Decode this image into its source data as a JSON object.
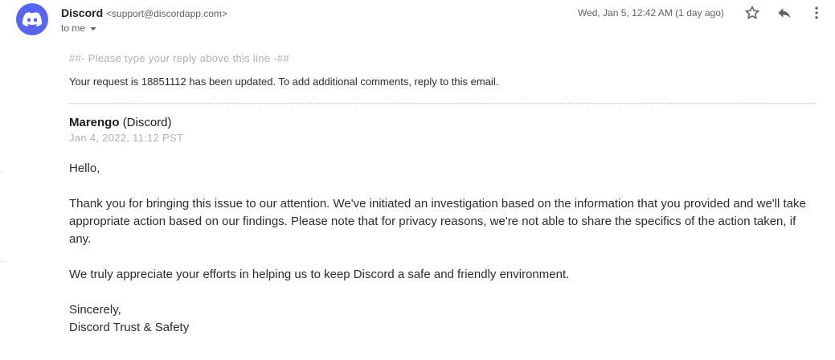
{
  "sender": {
    "name": "Discord",
    "email": "<support@discordapp.com>",
    "avatar_color": "#5865F2",
    "avatar_icon": "discord-logo-icon"
  },
  "recipient": {
    "label": "to me"
  },
  "header": {
    "date": "Wed, Jan 5, 12:42 AM (1 day ago)",
    "actions": {
      "star_icon": "star-icon",
      "reply_icon": "reply-icon",
      "more_icon": "more-vert-icon"
    }
  },
  "email": {
    "reply_hint": "##- Please type your reply above this line -##",
    "update_notice": "Your request is 18851112 has been updated. To add additional comments, reply to this email.",
    "author_name": "Marengo",
    "author_org": "(Discord)",
    "posted_at": "Jan 4, 2022, 11:12 PST",
    "greeting": "Hello,",
    "paragraph1": "Thank you for bringing this issue to our attention. We've initiated an investigation based on the information that you provided and we'll take appropriate action based on our findings. Please note that for privacy reasons, we're not able to share the specifics of the action taken, if any.",
    "paragraph2": "We truly appreciate your efforts in helping us to keep Discord a safe and friendly environment.",
    "closing": "Sincerely,",
    "signature": "Discord Trust & Safety"
  }
}
